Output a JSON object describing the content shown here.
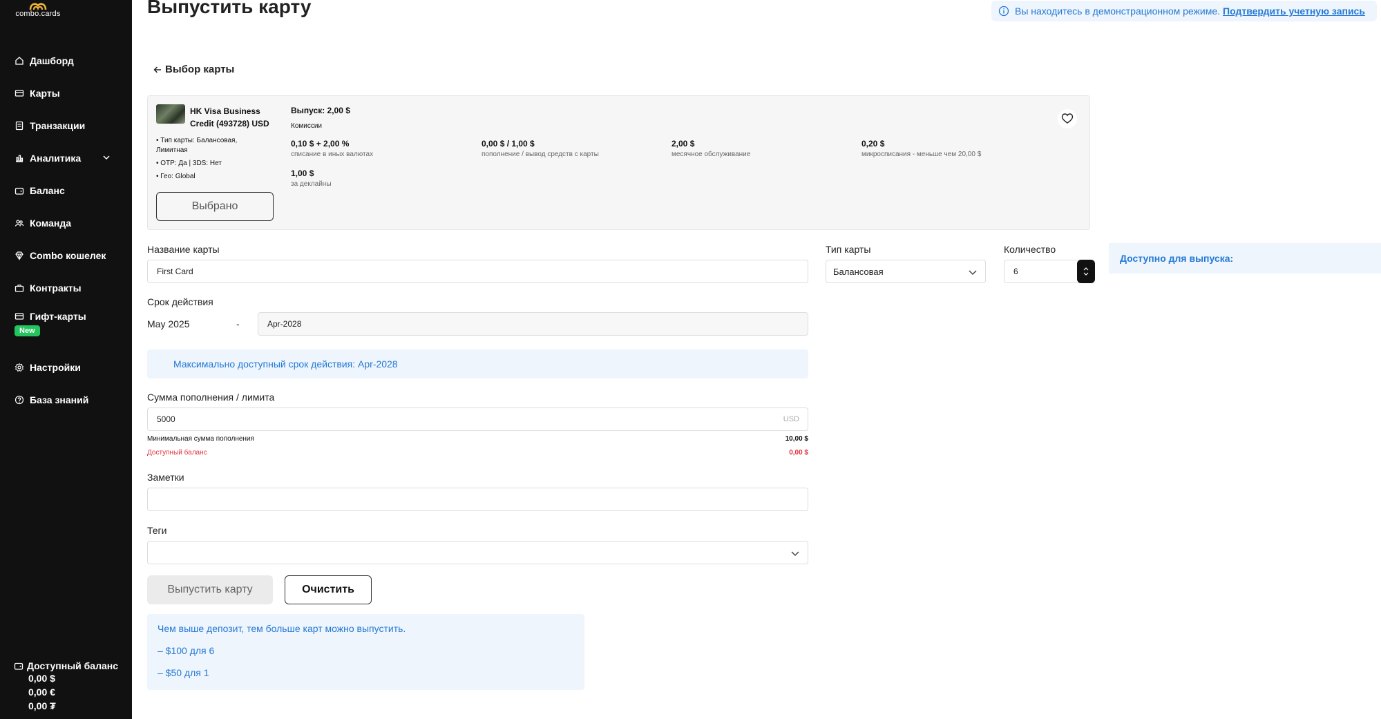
{
  "sidebar": {
    "logo_text": "combo.cards",
    "items": [
      {
        "label": "Дашборд",
        "icon": "home-icon"
      },
      {
        "label": "Карты",
        "icon": "card-icon"
      },
      {
        "label": "Транзакции",
        "icon": "receipt-icon"
      },
      {
        "label": "Аналитика",
        "icon": "chart-icon"
      },
      {
        "label": "Баланс",
        "icon": "wallet-icon"
      },
      {
        "label": "Команда",
        "icon": "team-icon"
      },
      {
        "label": "Combo кошелек",
        "icon": "diamond-icon"
      },
      {
        "label": "Контракты",
        "icon": "briefcase-icon"
      },
      {
        "label": "Гифт-карты",
        "icon": "gift-card-icon",
        "badge": "New"
      },
      {
        "label": "Настройки",
        "icon": "gear-icon"
      },
      {
        "label": "База знаний",
        "icon": "help-icon"
      }
    ],
    "balance": {
      "title": "Доступный баланс",
      "usd": "0,00 $",
      "eur": "0,00 €",
      "uah": "0,00 ₮"
    }
  },
  "header": {
    "title": "Выпустить карту",
    "demo_text": "Вы находитесь в демонстрационном режиме.",
    "demo_link": "Подтвердить учетную запись"
  },
  "back_label": "Выбор карты",
  "card": {
    "name": "HK Visa Business Credit (493728) USD",
    "features": [
      "• Тип карты: Балансовая, Лимитная",
      "• OTP: Да | 3DS: Нет",
      "• Гео: Global"
    ],
    "selected_label": "Выбрано",
    "issue": "Выпуск: 2,00 $",
    "commissions_label": "Комиссии",
    "fees": [
      {
        "value": "0,10 $ + 2,00 %",
        "desc": "списание в иных валютах"
      },
      {
        "value": "0,00 $ / 1,00 $",
        "desc": "пополнение / вывод средств с карты"
      },
      {
        "value": "2,00 $",
        "desc": "месячное обслуживание"
      },
      {
        "value": "0,20 $",
        "desc": "микросписания - меньше чем 20,00 $"
      },
      {
        "value": "1,00 $",
        "desc": "за деклайны"
      }
    ]
  },
  "form": {
    "card_name_label": "Название карты",
    "card_name_value": "First Card",
    "card_type_label": "Тип карты",
    "card_type_value": "Балансовая",
    "quantity_label": "Количество",
    "quantity_value": "6",
    "available_label": "Доступно для выпуска:",
    "validity_label": "Срок действия",
    "validity_from": "May 2025",
    "validity_dash": "-",
    "validity_to": "Apr-2028",
    "max_validity": "Максимально доступный срок действия: Apr-2028",
    "amount_label": "Сумма пополнения / лимита",
    "amount_value": "5000",
    "amount_currency": "USD",
    "min_topup_label": "Минимальная сумма пополнения",
    "min_topup_value": "10,00 $",
    "available_balance_label": "Доступный баланс",
    "available_balance_value": "0,00 $",
    "notes_label": "Заметки",
    "tags_label": "Теги",
    "issue_button": "Выпустить карту",
    "clear_button": "Очистить"
  },
  "deposit_info": {
    "line1": "Чем выше депозит, тем больше карт можно выпустить.",
    "line2": "– $100 для 6",
    "line3": "– $50 для 1"
  },
  "colors": {
    "sidebar_bg": "#111111",
    "accent_blue": "#2479d4",
    "info_bg": "#eef5fd",
    "badge_green": "#22c55e",
    "error_red": "#e0303a"
  }
}
